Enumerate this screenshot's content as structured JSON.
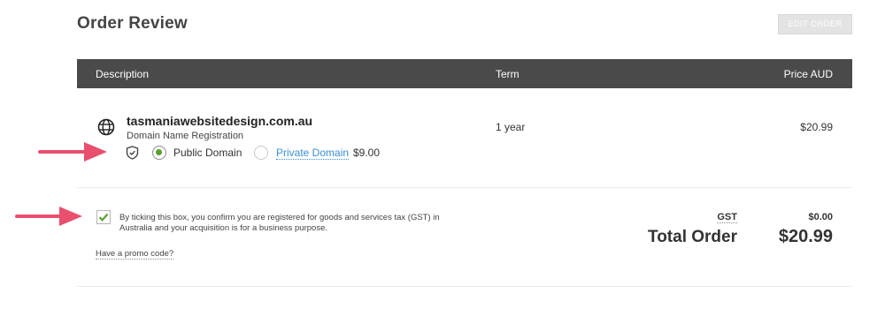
{
  "header": {
    "title": "Order Review",
    "edit_button": "EDIT ORDER"
  },
  "table": {
    "columns": [
      "Description",
      "Term",
      "Price AUD"
    ]
  },
  "item": {
    "icon": "globe-icon",
    "domain": "tasmaniawebsitedesign.com.au",
    "type": "Domain Name Registration",
    "term": "1 year",
    "price": "$20.99",
    "options": {
      "public_label": "Public Domain",
      "public_selected": true,
      "private_label": "Private Domain",
      "private_price": "$9.00"
    }
  },
  "gst": {
    "checked": true,
    "text": "By ticking this box, you confirm you are registered for goods and services tax (GST) in Australia and your acquisition is for a business purpose.",
    "promo_link": "Have a promo code?",
    "gst_label": "GST",
    "gst_value": "$0.00",
    "total_label": "Total Order",
    "total_value": "$20.99"
  },
  "colors": {
    "header_bg": "#4a4a4a",
    "accent_green": "#5aa02c",
    "link_blue": "#3a8fd8",
    "arrow_pink": "#e8506e"
  }
}
